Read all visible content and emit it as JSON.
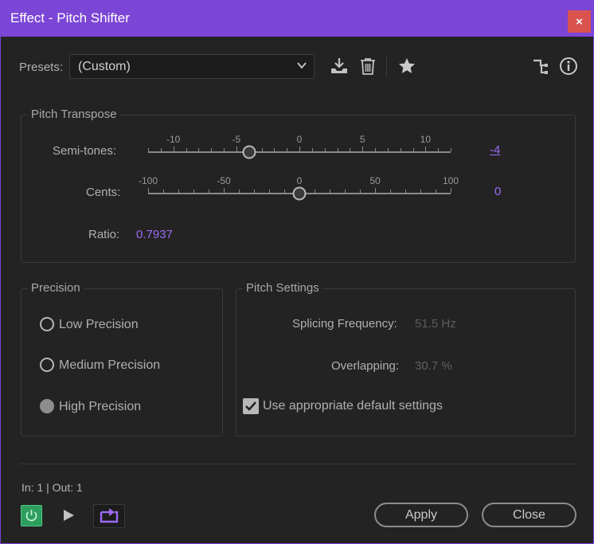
{
  "window": {
    "title": "Effect - Pitch Shifter",
    "close_glyph": "×",
    "colors": {
      "titlebar": "#7b45d6",
      "accent": "#9b6bf5",
      "close": "#d9534f",
      "power_on": "#2e9e5e"
    }
  },
  "presets": {
    "label": "Presets:",
    "selected": "(Custom)",
    "icons": [
      "save-preset-icon",
      "delete-preset-icon",
      "favorite-star-icon",
      "routing-icon",
      "info-icon"
    ]
  },
  "pitch_transpose": {
    "title": "Pitch Transpose",
    "semitones": {
      "label": "Semi-tones:",
      "value": -4,
      "value_text": "-4",
      "min": -12,
      "max": 12,
      "tick_labels": [
        "-10",
        "-5",
        "0",
        "5",
        "10"
      ]
    },
    "cents": {
      "label": "Cents:",
      "value": 0,
      "value_text": "0",
      "min": -100,
      "max": 100,
      "tick_labels": [
        "-100",
        "-50",
        "0",
        "50",
        "100"
      ]
    },
    "ratio": {
      "label": "Ratio:",
      "value": "0.7937"
    }
  },
  "precision": {
    "title": "Precision",
    "options": [
      {
        "label": "Low Precision",
        "checked": false
      },
      {
        "label": "Medium Precision",
        "checked": false
      },
      {
        "label": "High Precision",
        "checked": true
      }
    ]
  },
  "pitch_settings": {
    "title": "Pitch Settings",
    "splicing": {
      "label": "Splicing Frequency:",
      "value": "51.5 Hz"
    },
    "overlapping": {
      "label": "Overlapping:",
      "value": "30.7 %"
    },
    "default_checkbox": {
      "label": "Use appropriate default settings",
      "checked": true
    }
  },
  "footer": {
    "io": "In: 1 | Out: 1",
    "apply_label": "Apply",
    "close_label": "Close",
    "icons": [
      "power-icon",
      "play-icon",
      "loop-icon"
    ]
  }
}
